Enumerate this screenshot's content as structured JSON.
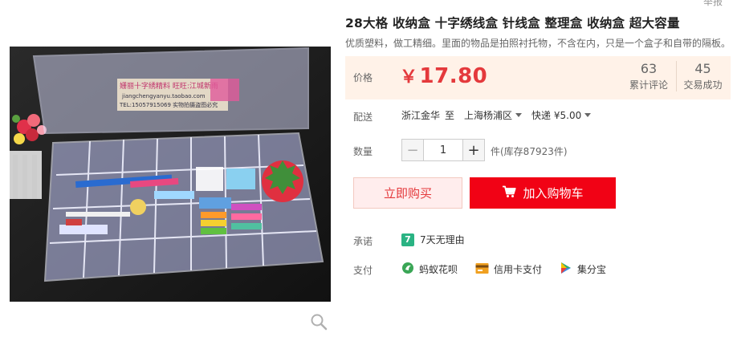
{
  "product": {
    "title": "28大格 收纳盒 十字绣线盒 针线盒 整理盒 收纳盒 超大容量",
    "subtitle": "优质塑料，做工精细。里面的物品是拍照衬托物，不含在内，只是一个盒子和自带的隔板。",
    "top_right_text": "举报"
  },
  "gallery": {
    "watermark_line1": "姗丽十字绣精料   旺旺:江城新雨",
    "watermark_line2": "jiangchengyanyu.taobao.com",
    "watermark_line3": "TEL:15057915069   实物拍摄盗图必究",
    "zoom_icon": "magnifier-icon"
  },
  "price": {
    "label": "价格",
    "currency": "￥",
    "value": "17.80",
    "reviews_count": "63",
    "reviews_label": "累计评论",
    "sales_count": "45",
    "sales_label": "交易成功"
  },
  "shipping": {
    "label": "配送",
    "from": "浙江金华",
    "to_word": "至",
    "to": "上海杨浦区",
    "method": "快递 ¥5.00"
  },
  "quantity": {
    "label": "数量",
    "minus": "−",
    "value": "1",
    "plus": "+",
    "stock": "件(库存87923件)"
  },
  "actions": {
    "buy_now": "立即购买",
    "add_to_cart": "加入购物车"
  },
  "promise": {
    "label": "承诺",
    "badge": "7",
    "text": "7天无理由"
  },
  "payment": {
    "label": "支付",
    "methods": [
      "蚂蚁花呗",
      "信用卡支付",
      "集分宝"
    ]
  },
  "colors": {
    "price_red": "#e4393c",
    "cart_red": "#f10215",
    "price_bg": "#fff2e8",
    "promise_green": "#2ab383"
  }
}
